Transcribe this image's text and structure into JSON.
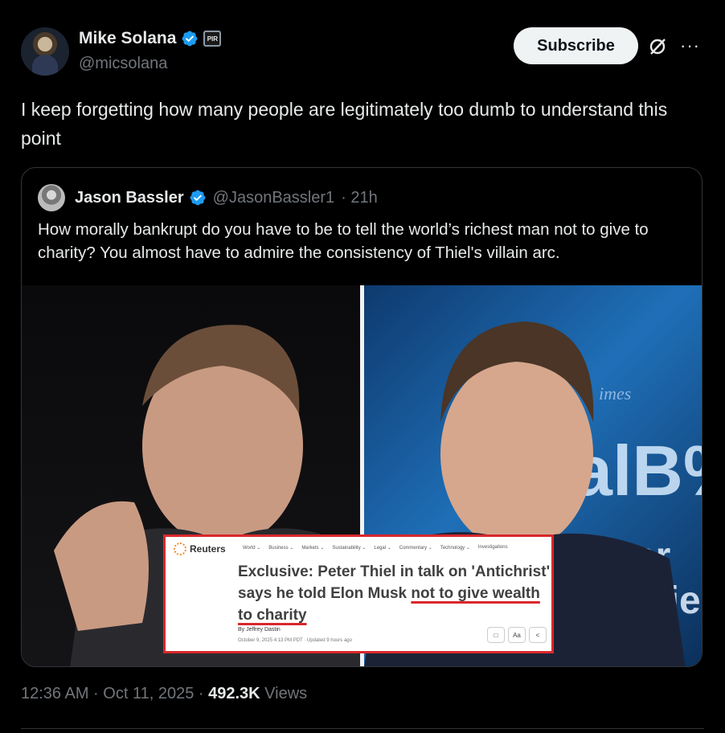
{
  "author": {
    "name": "Mike Solana",
    "handle": "@micsolana",
    "affiliation_badge": "PIR"
  },
  "actions": {
    "subscribe_label": "Subscribe",
    "more_label": "···"
  },
  "tweet": {
    "text": "I keep forgetting how many people are legitimately too dumb to understand this point"
  },
  "quote": {
    "name": "Jason Bassler",
    "handle": "@JasonBassler1",
    "time": "· 21h",
    "text": "How morally bankrupt do you have to be to tell the world’s richest man not to give to charity? You almost have to admire the consistency of Thiel's villain arc."
  },
  "reuters_card": {
    "brand": "Reuters",
    "nav": [
      "World ⌄",
      "Business ⌄",
      "Markets ⌄",
      "Sustainability ⌄",
      "Legal ⌄",
      "Commentary ⌄",
      "Technology ⌄",
      "Investigations"
    ],
    "headline_part1": "Exclusive: Peter Thiel in talk on 'Antichrist' says he told Elon Musk ",
    "headline_underlined": "not to give wealth to charity",
    "byline": "By Jeffrey Dastin",
    "date": "October 9, 2025 4:13 PM PDT · Updated 9 hours ago"
  },
  "background_sign": {
    "small": "imes",
    "big": "alB%",
    "bottom": "ter Thie"
  },
  "meta": {
    "time": "12:36 AM · Oct 11, 2025 · ",
    "views_count": "492.3K",
    "views_label": " Views"
  },
  "colors": {
    "verified": "#1d9bf0",
    "underline": "#d8282b",
    "background": "#000000"
  }
}
